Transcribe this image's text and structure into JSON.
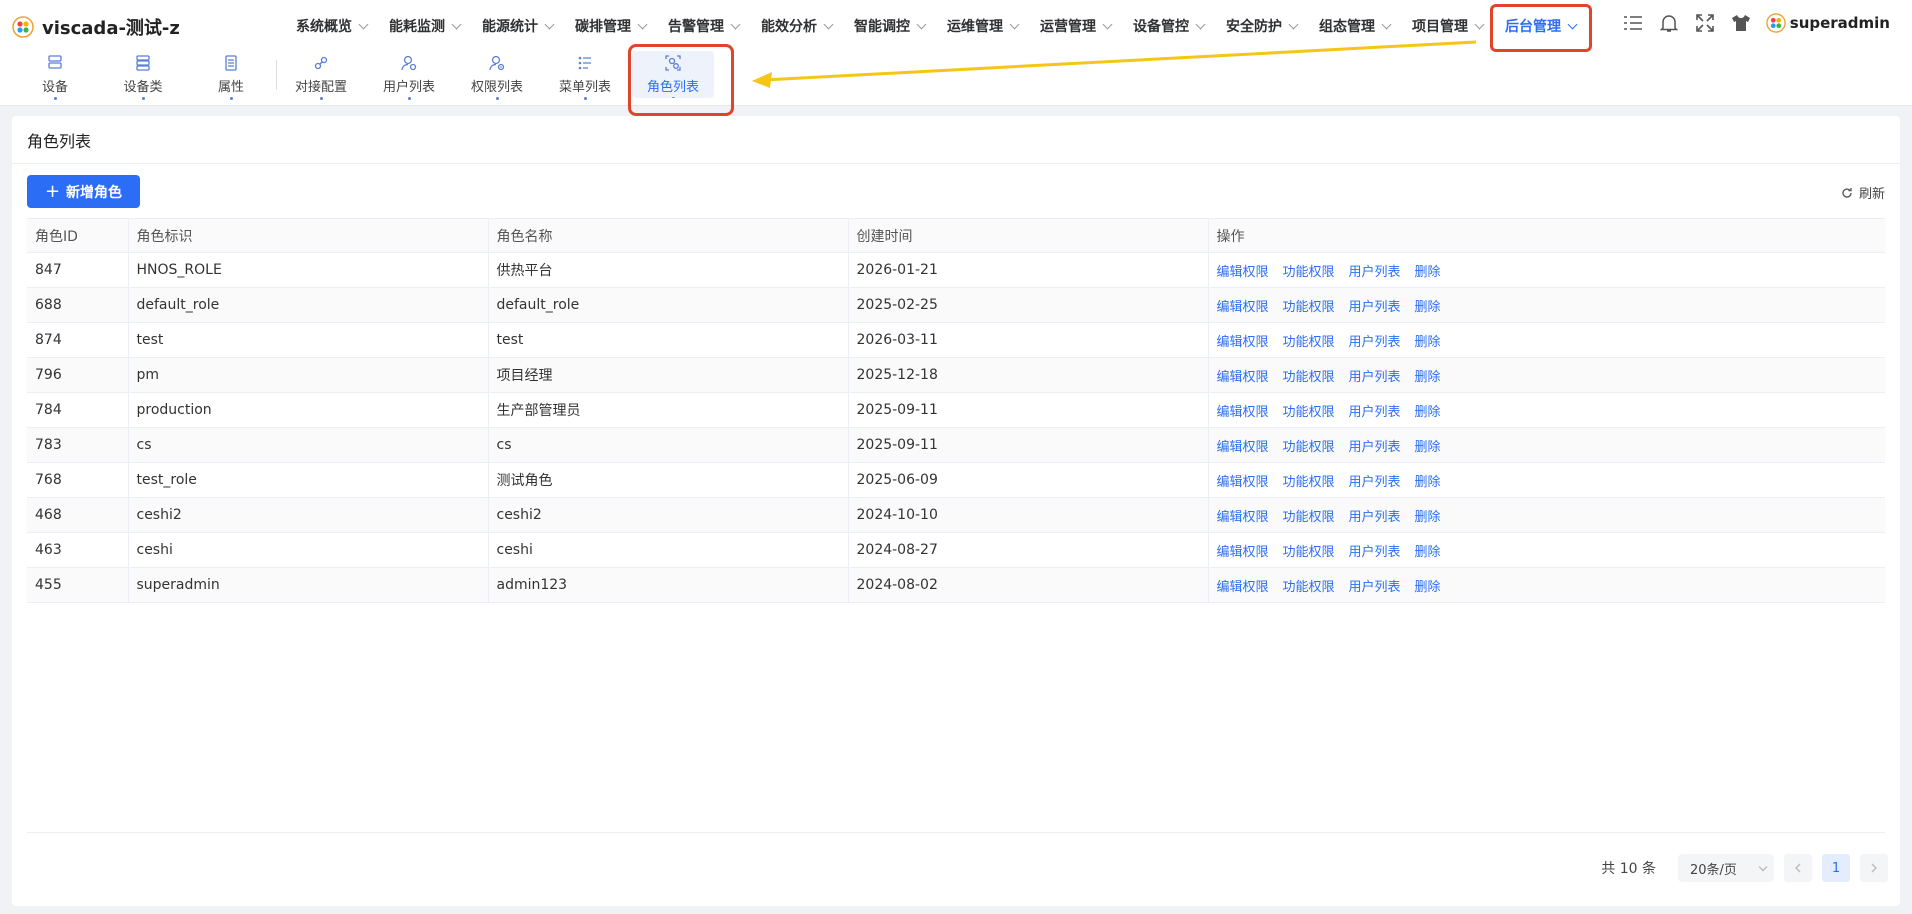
{
  "app": {
    "title": "viscada-测试-z"
  },
  "menu": [
    {
      "label": "系统概览"
    },
    {
      "label": "能耗监测"
    },
    {
      "label": "能源统计"
    },
    {
      "label": "碳排管理"
    },
    {
      "label": "告警管理"
    },
    {
      "label": "能效分析"
    },
    {
      "label": "智能调控"
    },
    {
      "label": "运维管理"
    },
    {
      "label": "运营管理"
    },
    {
      "label": "设备管控"
    },
    {
      "label": "安全防护"
    },
    {
      "label": "组态管理"
    },
    {
      "label": "项目管理"
    },
    {
      "label": "后台管理",
      "active": true
    }
  ],
  "user": {
    "name": "superadmin"
  },
  "subnav": [
    {
      "label": "设备",
      "icon": "device-icon"
    },
    {
      "label": "设备类",
      "icon": "device-class-icon"
    },
    {
      "label": "属性",
      "icon": "property-icon"
    },
    {
      "label": "对接配置",
      "icon": "link-icon"
    },
    {
      "label": "用户列表",
      "icon": "user-icon"
    },
    {
      "label": "权限列表",
      "icon": "permission-icon"
    },
    {
      "label": "菜单列表",
      "icon": "menu-list-icon"
    },
    {
      "label": "角色列表",
      "icon": "role-icon",
      "active": true
    }
  ],
  "page": {
    "title": "角色列表",
    "add_label": "新增角色",
    "refresh_label": "刷新"
  },
  "table": {
    "headers": [
      "角色ID",
      "角色标识",
      "角色名称",
      "创建时间",
      "操作"
    ],
    "actions": [
      "编辑权限",
      "功能权限",
      "用户列表",
      "删除"
    ],
    "rows": [
      [
        "847",
        "HNOS_ROLE",
        "供热平台",
        "2026-01-21"
      ],
      [
        "688",
        "default_role",
        "default_role",
        "2025-02-25"
      ],
      [
        "874",
        "test",
        "test",
        "2026-03-11"
      ],
      [
        "796",
        "pm",
        "项目经理",
        "2025-12-18"
      ],
      [
        "784",
        "production",
        "生产部管理员",
        "2025-09-11"
      ],
      [
        "783",
        "cs",
        "cs",
        "2025-09-11"
      ],
      [
        "768",
        "test_role",
        "测试角色",
        "2025-06-09"
      ],
      [
        "468",
        "ceshi2",
        "ceshi2",
        "2024-10-10"
      ],
      [
        "463",
        "ceshi",
        "ceshi",
        "2024-08-27"
      ],
      [
        "455",
        "superadmin",
        "admin123",
        "2024-08-02"
      ]
    ]
  },
  "pagination": {
    "total_text": "共 10 条",
    "page_size": "20条/页",
    "current_page": "1"
  },
  "colors": {
    "primary": "#2b6ef5",
    "highlight": "#e0452c",
    "arrow": "#f5c518"
  }
}
